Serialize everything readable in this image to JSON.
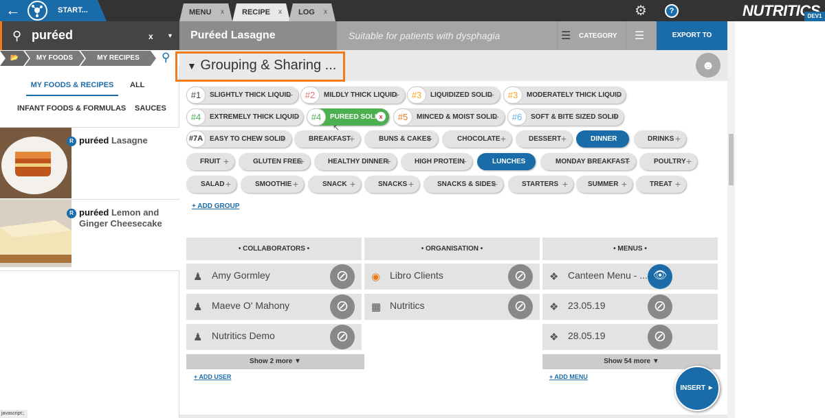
{
  "topbar": {
    "start_label": "START...",
    "tabs": [
      {
        "label": "MENU"
      },
      {
        "label": "RECIPE"
      },
      {
        "label": "LOG"
      }
    ],
    "tab_close": "x",
    "brand": "NUTRITICS",
    "env_badge": "DEV1"
  },
  "search": {
    "query": "puréed",
    "clear": "x"
  },
  "left_tabs": [
    "MY FOODS",
    "MY RECIPES"
  ],
  "filters": {
    "active": "MY FOODS & RECIPES",
    "all": "ALL",
    "infant": "INFANT FOODS & FORMULAS",
    "sauces": "SAUCES"
  },
  "results": [
    {
      "badge": "R",
      "prefix": "puréed",
      "name": "Lasagne"
    },
    {
      "badge": "R",
      "prefix": "puréed",
      "name": "Lemon and Ginger Cheesecake"
    }
  ],
  "status_text": "javascript:;",
  "recipe": {
    "name": "Puréed Lasagne",
    "description": "Suitable for patients with dysphagia",
    "category_label": "CATEGORY",
    "export_label": "EXPORT TO"
  },
  "section_title": "Grouping & Sharing ...",
  "chips": [
    {
      "num": "#1",
      "label": "SLIGHTLY THICK LIQUID"
    },
    {
      "num": "#2",
      "label": "MILDLY THICK LIQUID"
    },
    {
      "num": "#3",
      "label": "LIQUIDIZED SOLID"
    },
    {
      "num": "#3",
      "label": "MODERATELY THICK LIQUID"
    },
    {
      "num": "#4",
      "label": "EXTREMELY THICK LIQUID"
    },
    {
      "num": "#4",
      "label": "PUREED SOLID"
    },
    {
      "num": "#5",
      "label": "MINCED & MOIST SOLID"
    },
    {
      "num": "#6",
      "label": "SOFT & BITE SIZED SOLID"
    },
    {
      "num": "#7A",
      "label": "EASY TO CHEW SOLID"
    },
    {
      "label": "BREAKFAST"
    },
    {
      "label": "BUNS & CAKES"
    },
    {
      "label": "CHOCOLATE"
    },
    {
      "label": "DESSERT"
    },
    {
      "label": "DINNER"
    },
    {
      "label": "DRINKS"
    },
    {
      "label": "FRUIT"
    },
    {
      "label": "GLUTEN FREE"
    },
    {
      "label": "HEALTHY DINNER"
    },
    {
      "label": "HIGH PROTEIN"
    },
    {
      "label": "LUNCHES"
    },
    {
      "label": "MONDAY BREAKFAST"
    },
    {
      "label": "POULTRY"
    },
    {
      "label": "SALAD"
    },
    {
      "label": "SMOOTHIE"
    },
    {
      "label": "SNACK"
    },
    {
      "label": "SNACKS"
    },
    {
      "label": "SNACKS & SIDES"
    },
    {
      "label": "STARTERS"
    },
    {
      "label": "SUMMER"
    },
    {
      "label": "TREAT"
    }
  ],
  "chip_add": "+",
  "chip_remove": "x",
  "add_group": "+ ADD GROUP",
  "collaborators": {
    "title": "• COLLABORATORS •",
    "items": [
      "Amy Gormley",
      "Maeve O' Mahony",
      "Nutritics Demo"
    ],
    "more": "Show 2 more ▼",
    "add": "+ ADD USER"
  },
  "organisation": {
    "title": "• ORGANISATION •",
    "items": [
      "Libro Clients",
      "Nutritics"
    ]
  },
  "menus": {
    "title": "• MENUS •",
    "items": [
      "Canteen Menu - ...",
      "23.05.19",
      "28.05.19"
    ],
    "more": "Show 54 more ▼",
    "add": "+ ADD MENU"
  },
  "insert_label": "INSERT ►",
  "colors": {
    "accent": "#1a6ca8",
    "highlight": "#f07a1a",
    "selected_chip": "#4caf50"
  },
  "icons": {
    "back": "back-arrow-icon",
    "settings": "gear-icon",
    "help": "help-icon",
    "search": "search-icon",
    "share": "add-user-icon",
    "remove": "ban-icon",
    "view": "eye-icon"
  }
}
